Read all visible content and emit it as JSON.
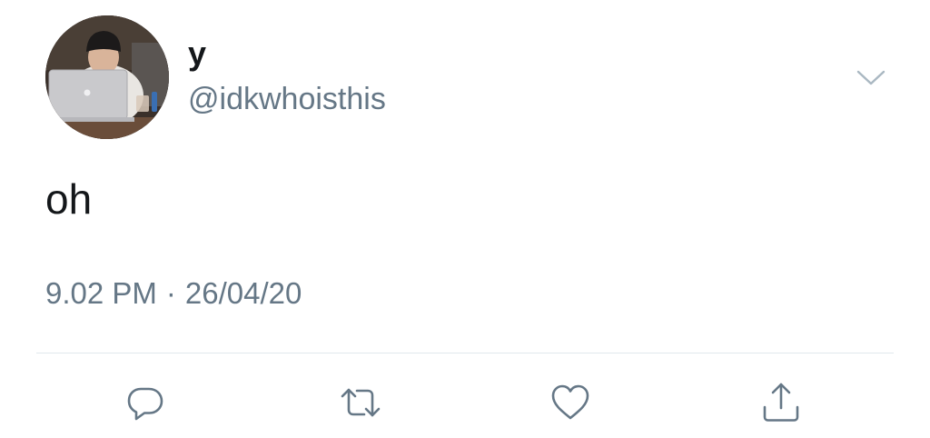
{
  "tweet": {
    "author": {
      "display_name": "y",
      "handle": "@idkwhoisthis"
    },
    "text": "oh",
    "time": "9.02 PM",
    "separator": "·",
    "date": "26/04/20"
  },
  "icons": {
    "menu": "chevron-down-icon",
    "reply": "reply-icon",
    "retweet": "retweet-icon",
    "like": "heart-icon",
    "share": "share-icon"
  },
  "colors": {
    "text_primary": "#14171a",
    "text_secondary": "#657786",
    "divider": "#e1e8ed"
  }
}
